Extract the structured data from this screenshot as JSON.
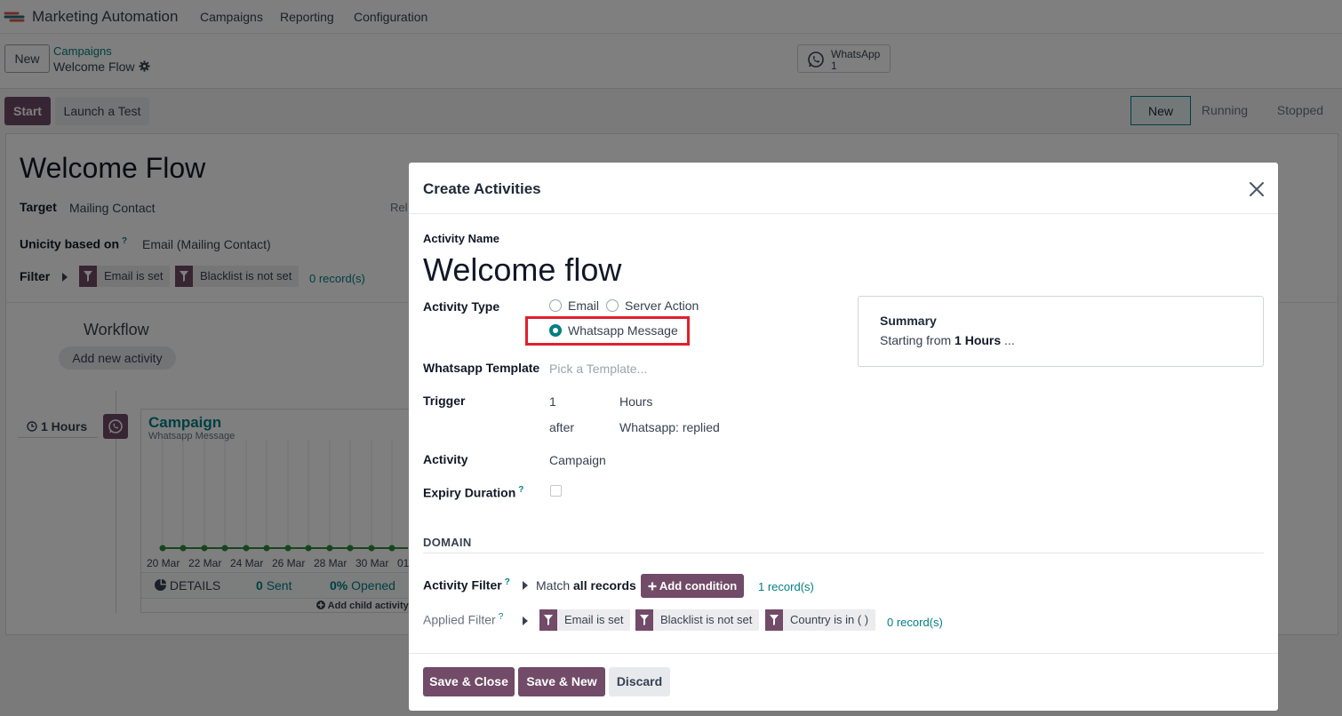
{
  "nav": {
    "app_title": "Marketing Automation",
    "menu": [
      "Campaigns",
      "Reporting",
      "Configuration"
    ]
  },
  "control_panel": {
    "new_label": "New",
    "breadcrumb_parent": "Campaigns",
    "breadcrumb_current": "Welcome Flow",
    "whatsapp_stat_label": "WhatsApp",
    "whatsapp_stat_count": "1"
  },
  "statusbar": {
    "start_label": "Start",
    "test_label": "Launch a Test",
    "stages": [
      "New",
      "Running",
      "Stopped"
    ],
    "active_stage": "New"
  },
  "form": {
    "title": "Welcome Flow",
    "target_label": "Target",
    "target_value": "Mailing Contact",
    "related_cut": "Rel",
    "unicity_label": "Unicity based on",
    "unicity_help": "?",
    "unicity_value": "Email (Mailing Contact)",
    "filter_label": "Filter",
    "filter_tags": [
      "Email is set",
      "Blacklist is not set"
    ],
    "filter_records": "0 record(s)",
    "workflow_title": "Workflow",
    "add_activity_label": "Add new activity",
    "interval_label": "1 Hours",
    "activity_card": {
      "title": "Campaign",
      "subtitle": "Whatsapp Message",
      "dates": [
        "20 Mar",
        "22 Mar",
        "24 Mar",
        "26 Mar",
        "28 Mar",
        "30 Mar",
        "01"
      ],
      "details_label": "DETAILS",
      "sent_value": "0",
      "sent_label": "Sent",
      "opened_value": "0%",
      "opened_label": "Opened",
      "add_child_label": "Add child activity"
    }
  },
  "modal": {
    "title": "Create Activities",
    "activity_name_label": "Activity Name",
    "activity_name_value": "Welcome flow",
    "activity_type_label": "Activity Type",
    "activity_type_options": [
      "Email",
      "Server Action",
      "Whatsapp Message"
    ],
    "activity_type_selected": "Whatsapp Message",
    "template_label": "Whatsapp Template",
    "template_placeholder": "Pick a Template...",
    "trigger_label": "Trigger",
    "trigger_interval": "1",
    "trigger_unit": "Hours",
    "trigger_when": "after",
    "trigger_event": "Whatsapp: replied",
    "activity_label": "Activity",
    "activity_value": "Campaign",
    "expiry_label": "Expiry Duration",
    "expiry_help": "?",
    "summary_title": "Summary",
    "summary_prefix": "Starting from",
    "summary_bold": "1 Hours",
    "summary_suffix": "...",
    "domain_title": "DOMAIN",
    "activity_filter_label": "Activity Filter",
    "activity_filter_help": "?",
    "match_prefix": "Match",
    "match_bold": "all records",
    "add_condition_label": "Add condition",
    "activity_filter_records": "1 record(s)",
    "applied_filter_label": "Applied Filter",
    "applied_filter_help": "?",
    "applied_tags": [
      "Email is set",
      "Blacklist is not set",
      "Country is in ( )"
    ],
    "applied_records": "0 record(s)",
    "buttons": {
      "save_close": "Save & Close",
      "save_new": "Save & New",
      "discard": "Discard"
    }
  },
  "colors": {
    "brand": "#714b67",
    "accent": "#017e84",
    "highlight": "#e0202c"
  },
  "icons": [
    "app-logo-icon",
    "gear-icon",
    "whatsapp-icon",
    "filter-icon",
    "caret-right-icon",
    "clock-icon",
    "pie-chart-icon",
    "plus-circle-icon",
    "close-icon",
    "plus-icon"
  ]
}
